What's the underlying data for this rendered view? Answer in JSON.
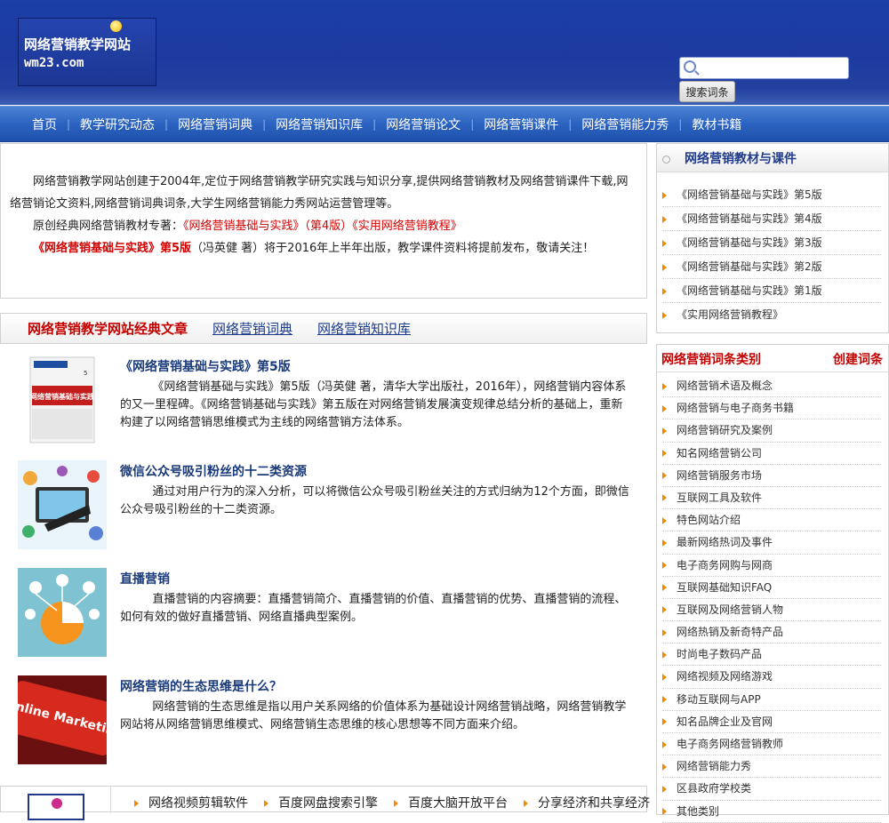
{
  "logo": {
    "line1": "网络营销教学网站",
    "line2": "wm23.com"
  },
  "search": {
    "placeholder": "",
    "button_label": "搜索词条"
  },
  "nav": {
    "items": [
      "首页",
      "教学研究动态",
      "网络营销词典",
      "网络营销知识库",
      "网络营销论文",
      "网络营销课件",
      "网络营销能力秀",
      "教材书籍"
    ]
  },
  "intro": {
    "p1": "网络营销教学网站创建于2004年,定位于网络营销教学研究实践与知识分享,提供网络营销教材及网络营销课件下载,网络营销论文资料,网络营销词典词条,大学生网络营销能力秀网站运营管理等。",
    "p2_prefix": "原创经典网络营销教材专著：",
    "p2_link": "《网络营销基础与实践》（第4版）《实用网络营销教程》",
    "p3_bold": "《网络营销基础与实践》第5版",
    "p3_rest": "（冯英健 著）将于2016年上半年出版，教学课件资料将提前发布，敬请关注！"
  },
  "tabs": {
    "active": "网络营销教学网站经典文章",
    "tab2": "网络营销词典",
    "tab3": "网络营销知识库"
  },
  "articles": [
    {
      "title": "《网络营销基础与实践》第5版",
      "desc": "《网络营销基础与实践》第5版（冯英健 著，清华大学出版社，2016年），网络营销内容体系的又一里程碑。《网络营销基础与实践》第五版在对网络营销发展演变规律总结分析的基础上，重新构建了以网络营销思维模式为主线的网络营销方法体系。",
      "thumb_text": "网络营销基础与实践"
    },
    {
      "title": "微信公众号吸引粉丝的十二类资源",
      "desc": "通过对用户行为的深入分析，可以将微信公众号吸引粉丝关注的方式归纳为12个方面，即微信公众号吸引粉丝的十二类资源。"
    },
    {
      "title": "直播营销",
      "desc": "直播营销的内容摘要：直播营销简介、直播营销的价值、直播营销的优势、直播营销的流程、如何有效的做好直播营销、网络直播典型案例。"
    },
    {
      "title": "网络营销的生态思维是什么？",
      "desc": "网络营销的生态思维是指以用户关系网络的价值体系为基础设计网络营销战略，网络营销教学网站将从网络营销思维模式、网络营销生态思维的核心思想等不同方面来介绍。",
      "thumb_text": "Online Marketing"
    }
  ],
  "bottom_links": [
    "网络视频剪辑软件",
    "百度网盘搜索引擎",
    "百度大脑开放平台",
    "分享经济和共享经济"
  ],
  "sidebar_books": {
    "title": "网络营销教材与课件",
    "items": [
      "《网络营销基础与实践》第5版",
      "《网络营销基础与实践》第4版",
      "《网络营销基础与实践》第3版",
      "《网络营销基础与实践》第2版",
      "《网络营销基础与实践》第1版",
      "《实用网络营销教程》"
    ]
  },
  "sidebar_categories": {
    "title": "网络营销词条类别",
    "create_label": "创建词条",
    "items": [
      "网络营销术语及概念",
      "网络营销与电子商务书籍",
      "网络营销研究及案例",
      "知名网络营销公司",
      "网络营销服务市场",
      "互联网工具及软件",
      "特色网站介绍",
      "最新网络热词及事件",
      "电子商务网购与网商",
      "互联网基础知识FAQ",
      "互联网及网络营销人物",
      "网络热销及新奇特产品",
      "时尚电子数码产品",
      "网络视频及网络游戏",
      "移动互联网与APP",
      "知名品牌企业及官网",
      "电子商务网络营销教师",
      "网络营销能力秀",
      "区县政府学校类",
      "其他类别"
    ]
  },
  "colors": {
    "nav_blue": "#2c63c0",
    "header_blue": "#1d3aa0",
    "accent_red": "#d20000",
    "arrow_orange": "#f08a00",
    "link_blue": "#1a3a8a"
  }
}
